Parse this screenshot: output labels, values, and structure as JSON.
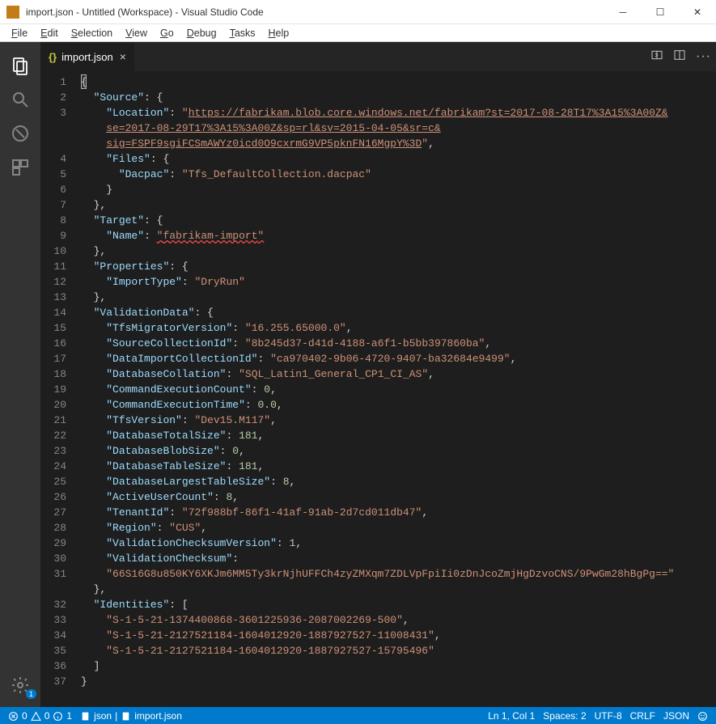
{
  "window": {
    "title": "import.json - Untitled (Workspace) - Visual Studio Code"
  },
  "menu": [
    "File",
    "Edit",
    "Selection",
    "View",
    "Go",
    "Debug",
    "Tasks",
    "Help"
  ],
  "activity": {
    "settings_badge": "1"
  },
  "tab": {
    "icon_text": "{}",
    "filename": "import.json"
  },
  "tab_actions": {
    "more": "···"
  },
  "code": {
    "source_key": "Source",
    "location_key": "Location",
    "location_val_1": "https://fabrikam.blob.core.windows.net/fabrikam?st=2017-08-28T17%3A15%3A00Z&",
    "location_val_2": "se=2017-08-29T17%3A15%3A00Z&sp=rl&sv=2015-04-05&sr=c&",
    "location_val_3": "sig=FSPF9sgiFCSmAWYz0icd0O9cxrmG9VP5pknFN16MgpY%3D",
    "files_key": "Files",
    "dacpac_key": "Dacpac",
    "dacpac_val": "Tfs_DefaultCollection.dacpac",
    "target_key": "Target",
    "name_key": "Name",
    "name_val": "fabrikam-import",
    "properties_key": "Properties",
    "importtype_key": "ImportType",
    "importtype_val": "DryRun",
    "validationdata_key": "ValidationData",
    "tfsmig_key": "TfsMigratorVersion",
    "tfsmig_val": "16.255.65000.0",
    "srccol_key": "SourceCollectionId",
    "srccol_val": "8b245d37-d41d-4188-a6f1-b5bb397860ba",
    "dataimp_key": "DataImportCollectionId",
    "dataimp_val": "ca970402-9b06-4720-9407-ba32684e9499",
    "dbcoll_key": "DatabaseCollation",
    "dbcoll_val": "SQL_Latin1_General_CP1_CI_AS",
    "cec_key": "CommandExecutionCount",
    "cec_val": "0",
    "cet_key": "CommandExecutionTime",
    "cet_val": "0.0",
    "tfsver_key": "TfsVersion",
    "tfsver_val": "Dev15.M117",
    "dbtot_key": "DatabaseTotalSize",
    "dbtot_val": "181",
    "dbblob_key": "DatabaseBlobSize",
    "dbblob_val": "0",
    "dbtab_key": "DatabaseTableSize",
    "dbtab_val": "181",
    "dblrg_key": "DatabaseLargestTableSize",
    "dblrg_val": "8",
    "auc_key": "ActiveUserCount",
    "auc_val": "8",
    "tenant_key": "TenantId",
    "tenant_val": "72f988bf-86f1-41af-91ab-2d7cd011db47",
    "region_key": "Region",
    "region_val": "CUS",
    "vcv_key": "ValidationChecksumVersion",
    "vcv_val": "1",
    "vc_key": "ValidationChecksum",
    "vc_val": "66S16G8u850KY6XKJm6MM5Ty3krNjhUFFCh4zyZMXqm7ZDLVpFpiIi0zDnJcoZmjHgDzvoCNS/9PwGm28hBgPg==",
    "ident_key": "Identities",
    "sid1": "S-1-5-21-1374400868-3601225936-2087002269-500",
    "sid2": "S-1-5-21-2127521184-1604012920-1887927527-11008431",
    "sid3": "S-1-5-21-2127521184-1604012920-1887927527-15795496"
  },
  "line_numbers": [
    "1",
    "2",
    "3",
    "",
    "",
    "4",
    "5",
    "6",
    "7",
    "8",
    "9",
    "10",
    "11",
    "12",
    "13",
    "14",
    "15",
    "16",
    "17",
    "18",
    "19",
    "20",
    "21",
    "22",
    "23",
    "24",
    "25",
    "26",
    "27",
    "28",
    "29",
    "30",
    "31",
    "",
    "32",
    "33",
    "34",
    "35",
    "36",
    "37"
  ],
  "status": {
    "errors": "0",
    "warnings": "0",
    "info": "1",
    "path_icon_label": "json",
    "path_file": "import.json",
    "ln_col": "Ln 1, Col 1",
    "spaces": "Spaces: 2",
    "encoding": "UTF-8",
    "eol": "CRLF",
    "lang": "JSON"
  }
}
